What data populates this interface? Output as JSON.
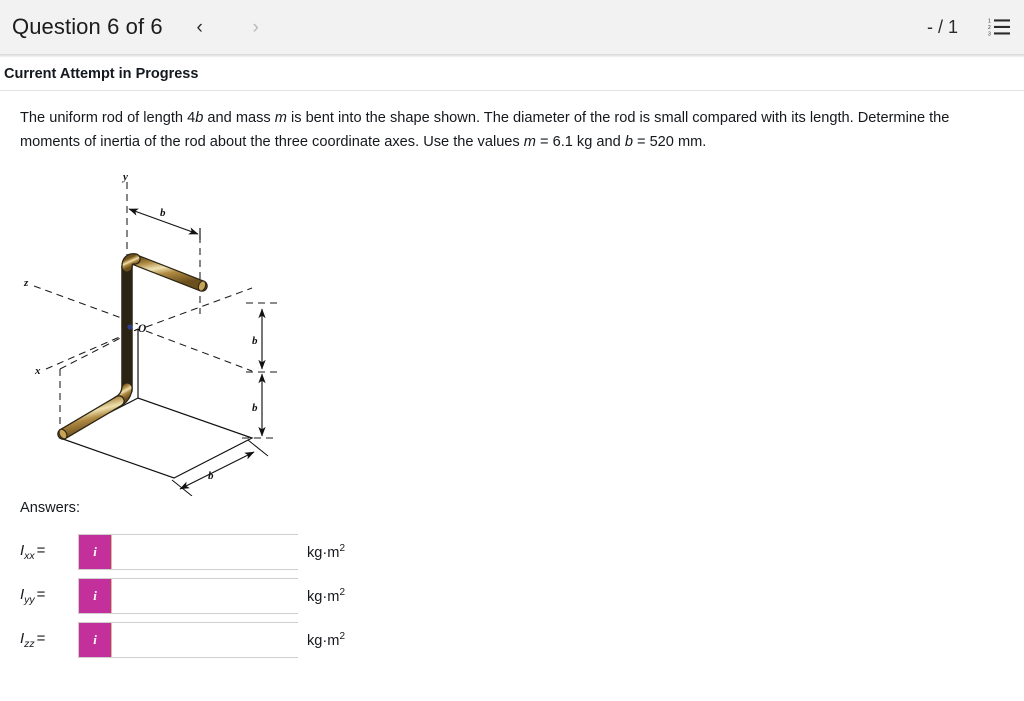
{
  "header": {
    "title": "Question 6 of 6",
    "prev_icon": "chevron-left-icon",
    "next_icon": "chevron-right-icon",
    "prev_label": "‹",
    "next_label": "›",
    "score": "- / 1",
    "list_icon": "numbered-list-icon"
  },
  "attempt": {
    "status": "Current Attempt in Progress"
  },
  "question": {
    "line1_a": "The uniform rod of length 4",
    "line1_b": "b",
    "line1_c": " and mass ",
    "line1_d": "m",
    "line1_e": " is bent into the shape shown. The diameter of the rod is small compared with its length.",
    "line2_a": "Determine the moments of inertia of the rod about the three coordinate axes. Use the values ",
    "line2_b": "m",
    "line2_c": " = 6.1 kg and ",
    "line2_d": "b",
    "line2_e": " = 520 mm."
  },
  "figure": {
    "axis_y": "y",
    "axis_x": "x",
    "axis_z": "z",
    "origin": "O",
    "dim_top": "b",
    "dim_mid": "b",
    "dim_low": "b",
    "dim_bottom": "b",
    "rod_color": "#b79246",
    "rod_highlight": "#f0e2b0",
    "rod_shadow": "#7d5f22"
  },
  "answers": {
    "heading": "Answers:",
    "rows": [
      {
        "symbol": "I",
        "subscript": "xx",
        "equals": "=",
        "value": "",
        "placeholder": "",
        "info_glyph": "i",
        "unit_main": "kg·m",
        "unit_exp": "2"
      },
      {
        "symbol": "I",
        "subscript": "yy",
        "equals": "=",
        "value": "",
        "placeholder": "",
        "info_glyph": "i",
        "unit_main": "kg·m",
        "unit_exp": "2"
      },
      {
        "symbol": "I",
        "subscript": "zz",
        "equals": "=",
        "value": "",
        "placeholder": "",
        "info_glyph": "i",
        "unit_main": "kg·m",
        "unit_exp": "2"
      }
    ]
  },
  "colors": {
    "header_bg": "#f2f2f2",
    "accent_magenta": "#c4309b",
    "text": "#15181d"
  }
}
